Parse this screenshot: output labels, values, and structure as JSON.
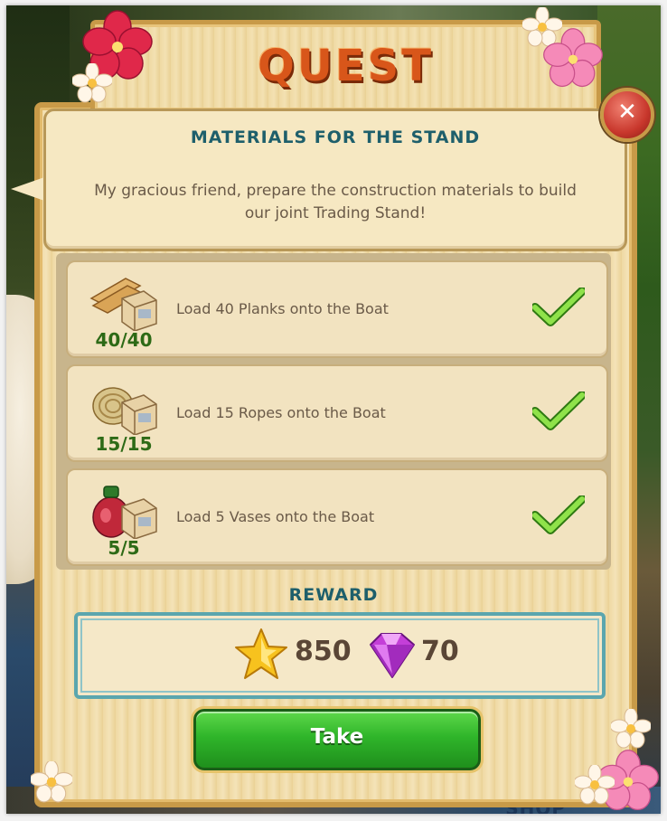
{
  "quest": {
    "title": "QUEST",
    "heading": "MATERIALS FOR THE STAND",
    "description": "My gracious friend, prepare the construction materials to build our joint Trading Stand!"
  },
  "tasks": [
    {
      "label": "Load 40 Planks onto the Boat",
      "progress": "40/40",
      "icon": "planks-crate-icon",
      "completed": true
    },
    {
      "label": "Load 15 Ropes onto the Boat",
      "progress": "15/15",
      "icon": "ropes-crate-icon",
      "completed": true
    },
    {
      "label": "Load 5 Vases onto the Boat",
      "progress": "5/5",
      "icon": "vase-crate-icon",
      "completed": true
    }
  ],
  "reward": {
    "heading": "REWARD",
    "xp": "850",
    "gems": "70"
  },
  "take_button": {
    "label": "Take"
  },
  "close_button": {
    "label": "✕"
  },
  "background": {
    "shop_label": "SHOP"
  },
  "colors": {
    "title": "#d8561a",
    "heading": "#1e5f6b",
    "count": "#2d6a16",
    "button": "#2fb52a"
  }
}
